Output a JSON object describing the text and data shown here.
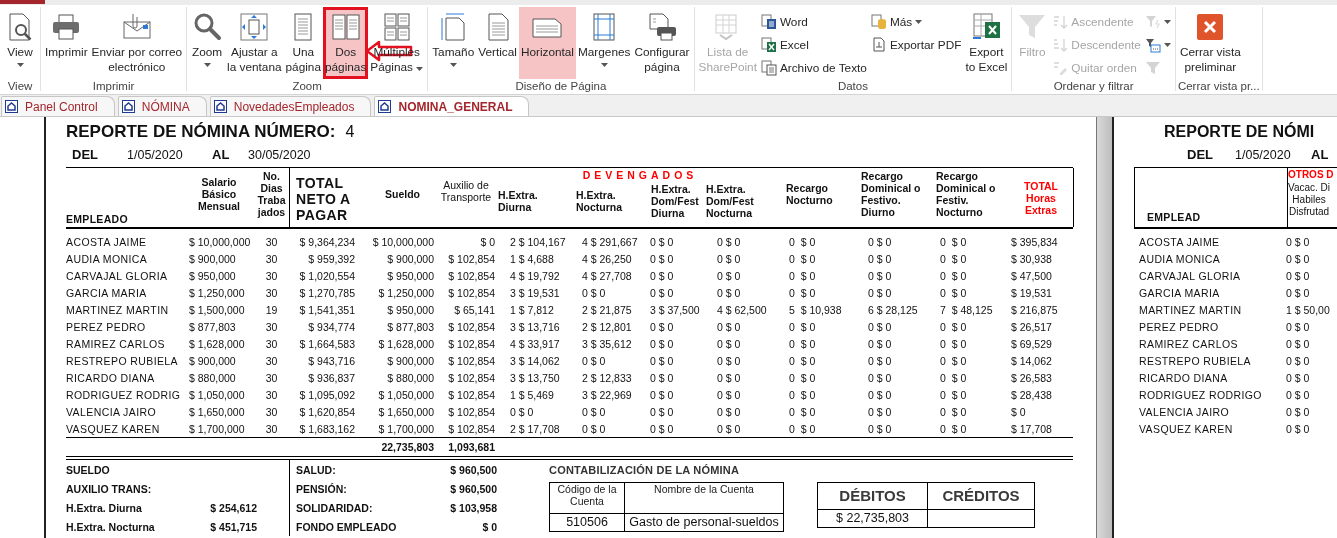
{
  "ribbon": {
    "groups": [
      {
        "label": "View",
        "items": [
          {
            "kind": "large",
            "label": "View",
            "dropdown": true,
            "disabled": false,
            "selected": false
          }
        ]
      },
      {
        "label": "Imprimir",
        "items": [
          {
            "kind": "large",
            "label": "Imprimir",
            "dropdown": false,
            "disabled": false,
            "selected": false
          },
          {
            "kind": "large",
            "label": "Enviar por correo\nelectrónico",
            "dropdown": false,
            "disabled": false,
            "selected": false
          }
        ]
      },
      {
        "label": "Zoom",
        "items": [
          {
            "kind": "large",
            "label": "Zoom",
            "dropdown": true,
            "disabled": false,
            "selected": false
          },
          {
            "kind": "large",
            "label": "Ajustar a\nla ventana",
            "dropdown": false,
            "disabled": false,
            "selected": false
          },
          {
            "kind": "large",
            "label": "Una\npágina",
            "dropdown": false,
            "disabled": false,
            "selected": false
          },
          {
            "kind": "large",
            "label": "Dos\npáginas",
            "dropdown": false,
            "disabled": false,
            "selected": true,
            "annotated": true
          },
          {
            "kind": "large",
            "label": "Múltiples\nPáginas",
            "dropdown": true,
            "disabled": false,
            "selected": false
          }
        ]
      },
      {
        "label": "Diseño de Página",
        "items": [
          {
            "kind": "large",
            "label": "Tamaño",
            "dropdown": true,
            "disabled": false,
            "selected": false
          },
          {
            "kind": "large",
            "label": "Vertical",
            "dropdown": false,
            "disabled": false,
            "selected": false
          },
          {
            "kind": "large",
            "label": "Horizontal",
            "dropdown": false,
            "disabled": false,
            "selected": true
          },
          {
            "kind": "large",
            "label": "Margenes",
            "dropdown": true,
            "disabled": false,
            "selected": false
          },
          {
            "kind": "large",
            "label": "Configurar\npágina",
            "dropdown": false,
            "disabled": false,
            "selected": false
          }
        ]
      },
      {
        "label": "Datos",
        "items": [
          {
            "kind": "large",
            "label": "Lista de\nSharePoint",
            "dropdown": false,
            "disabled": true,
            "selected": false
          },
          {
            "kind": "stack",
            "items": [
              {
                "label": "Word",
                "dropdown": false,
                "disabled": false
              },
              {
                "label": "Excel",
                "dropdown": false,
                "disabled": false
              },
              {
                "label": "Archivo de Texto",
                "dropdown": false,
                "disabled": false
              }
            ]
          },
          {
            "kind": "stack",
            "items": [
              {
                "label": "Más",
                "dropdown": true,
                "disabled": false
              },
              {
                "label": "Exportar PDF",
                "dropdown": false,
                "disabled": false
              }
            ]
          },
          {
            "kind": "large",
            "label": "Export\nto Excel",
            "dropdown": false,
            "disabled": false,
            "selected": false
          }
        ]
      },
      {
        "label": "Ordenar y filtrar",
        "items": [
          {
            "kind": "large",
            "label": "Filtro",
            "dropdown": false,
            "disabled": true,
            "selected": false
          },
          {
            "kind": "stack",
            "items": [
              {
                "label": "Ascendente",
                "dropdown": false,
                "disabled": true
              },
              {
                "label": "Descendente",
                "dropdown": false,
                "disabled": true
              },
              {
                "label": "Quitar orden",
                "dropdown": false,
                "disabled": true
              }
            ]
          },
          {
            "kind": "stack",
            "items": [
              {
                "dropdown": true,
                "disabled": true
              },
              {
                "dropdown": true,
                "disabled": false
              },
              {
                "dropdown": false,
                "disabled": true
              }
            ]
          }
        ]
      },
      {
        "label": "Cerrar vista pr...",
        "items": [
          {
            "kind": "large",
            "label": "Cerrar vista\npreliminar",
            "dropdown": false,
            "disabled": false,
            "selected": false
          }
        ]
      }
    ]
  },
  "tabs": [
    {
      "label": "Panel Control",
      "selected": false
    },
    {
      "label": "NÓMINA",
      "selected": false
    },
    {
      "label": "NovedadesEmpleados",
      "selected": false
    },
    {
      "label": "NOMINA_GENERAL",
      "selected": true
    }
  ],
  "report": {
    "title": "REPORTE DE NÓMINA NÚMERO:",
    "number": "4",
    "from_label": "DEL",
    "from": "1/05/2020",
    "to_label": "AL",
    "to": "30/05/2020",
    "group_header": "DEVENGADOS",
    "columns": [
      {
        "header": "EMPLEADO",
        "kind": "name",
        "grouped": false
      },
      {
        "header": "Salario\nBásico\nMensual",
        "kind": "normal",
        "grouped": false
      },
      {
        "header": "No.\nDias\nTraba\njados",
        "kind": "normal",
        "grouped": false
      },
      {
        "header": "TOTAL\nNETO A\nPAGAR",
        "kind": "large",
        "grouped": false
      },
      {
        "header": "Sueldo",
        "kind": "normal",
        "grouped": false,
        "total": "22,735,803"
      },
      {
        "header": "Auxilio de\nTransporte",
        "kind": "light",
        "grouped": false,
        "total": "1,093,681"
      },
      {
        "header": "H.Extra.\nDiurna",
        "kind": "normal",
        "grouped": true
      },
      {
        "header": "H.Extra.\nNocturna",
        "kind": "normal",
        "grouped": true
      },
      {
        "header": "H.Extra.\nDom/Fest\nDiurna",
        "kind": "normal",
        "grouped": true
      },
      {
        "header": "H.Extra.\nDom/Fest\nNocturna",
        "kind": "normal",
        "grouped": true
      },
      {
        "header": "Recargo\nNocturno",
        "kind": "normal",
        "grouped": false
      },
      {
        "header": "Recargo\nDominical o\nFestivo.\nDiurno",
        "kind": "normal",
        "grouped": false
      },
      {
        "header": "Recargo\nDominical o\nFestiv.\nNocturno",
        "kind": "normal",
        "grouped": false
      },
      {
        "header": "TOTAL\nHoras\nExtras",
        "kind": "accent",
        "grouped": false
      }
    ],
    "rows": [
      {
        "cells": [
          "ACOSTA JAIME",
          "$ 10,000,000",
          "30",
          "$ 9,364,234",
          "$ 10,000,000",
          "$ 0",
          "2 $ 104,167",
          "4 $ 291,667",
          "0 $ 0",
          "0 $ 0",
          "0  $ 0",
          "0 $ 0",
          "0  $ 0",
          "$ 395,834"
        ]
      },
      {
        "cells": [
          "AUDIA MONICA",
          "$ 900,000",
          "30",
          "$ 959,392",
          "$ 900,000",
          "$ 102,854",
          "1 $ 4,688",
          "4 $ 26,250",
          "0 $ 0",
          "0 $ 0",
          "0  $ 0",
          "0 $ 0",
          "0  $ 0",
          "$ 30,938"
        ]
      },
      {
        "cells": [
          "CARVAJAL GLORIA",
          "$ 950,000",
          "30",
          "$ 1,020,554",
          "$ 950,000",
          "$ 102,854",
          "4 $ 19,792",
          "4 $ 27,708",
          "0 $ 0",
          "0 $ 0",
          "0  $ 0",
          "0 $ 0",
          "0  $ 0",
          "$ 47,500"
        ]
      },
      {
        "cells": [
          "GARCIA MARIA",
          "$ 1,250,000",
          "30",
          "$ 1,270,785",
          "$ 1,250,000",
          "$ 102,854",
          "3 $ 19,531",
          "0 $ 0",
          "0 $ 0",
          "0 $ 0",
          "0  $ 0",
          "0 $ 0",
          "0  $ 0",
          "$ 19,531"
        ]
      },
      {
        "cells": [
          "MARTINEZ MARTIN",
          "$ 1,500,000",
          "19",
          "$ 1,541,351",
          "$ 950,000",
          "$ 65,141",
          "1 $ 7,812",
          "2 $ 21,875",
          "3 $ 37,500",
          "4 $ 62,500",
          "5  $ 10,938",
          "6 $ 28,125",
          "7  $ 48,125",
          "$ 216,875"
        ]
      },
      {
        "cells": [
          "PEREZ PEDRO",
          "$ 877,803",
          "30",
          "$ 934,774",
          "$ 877,803",
          "$ 102,854",
          "3 $ 13,716",
          "2 $ 12,801",
          "0 $ 0",
          "0 $ 0",
          "0  $ 0",
          "0 $ 0",
          "0  $ 0",
          "$ 26,517"
        ]
      },
      {
        "cells": [
          "RAMIREZ CARLOS",
          "$ 1,628,000",
          "30",
          "$ 1,664,583",
          "$ 1,628,000",
          "$ 102,854",
          "4 $ 33,917",
          "3 $ 35,612",
          "0 $ 0",
          "0 $ 0",
          "0  $ 0",
          "0 $ 0",
          "0  $ 0",
          "$ 69,529"
        ]
      },
      {
        "cells": [
          "RESTREPO RUBIELA",
          "$ 900,000",
          "30",
          "$ 943,716",
          "$ 900,000",
          "$ 102,854",
          "3 $ 14,062",
          "0 $ 0",
          "0 $ 0",
          "0 $ 0",
          "0  $ 0",
          "0 $ 0",
          "0  $ 0",
          "$ 14,062"
        ]
      },
      {
        "cells": [
          "RICARDO DIANA",
          "$ 880,000",
          "30",
          "$ 936,837",
          "$ 880,000",
          "$ 102,854",
          "3 $ 13,750",
          "2 $ 12,833",
          "0 $ 0",
          "0 $ 0",
          "0  $ 0",
          "0 $ 0",
          "0  $ 0",
          "$ 26,583"
        ]
      },
      {
        "cells": [
          "RODRIGUEZ RODRIG",
          "$ 1,050,000",
          "30",
          "$ 1,095,092",
          "$ 1,050,000",
          "$ 102,854",
          "1 $ 5,469",
          "3 $ 22,969",
          "0 $ 0",
          "0 $ 0",
          "0  $ 0",
          "0 $ 0",
          "0  $ 0",
          "$ 28,438"
        ]
      },
      {
        "cells": [
          "VALENCIA JAIRO",
          "$ 1,650,000",
          "30",
          "$ 1,620,854",
          "$ 1,650,000",
          "$ 102,854",
          "0 $ 0",
          "0 $ 0",
          "0 $ 0",
          "0 $ 0",
          "0  $ 0",
          "0 $ 0",
          "0  $ 0",
          "$ 0"
        ]
      },
      {
        "cells": [
          "VASQUEZ KAREN",
          "$ 1,700,000",
          "30",
          "$ 1,683,162",
          "$ 1,700,000",
          "$ 102,854",
          "2 $ 17,708",
          "0 $ 0",
          "0 $ 0",
          "0 $ 0",
          "0  $ 0",
          "0 $ 0",
          "0  $ 0",
          "$ 17,708"
        ]
      }
    ],
    "earnings": [
      {
        "label": "SUELDO"
      },
      {
        "label": "AUXILIO TRANS:"
      },
      {
        "label": "H.Extra. Diurna",
        "value": "$ 254,612"
      },
      {
        "label": "H.Extra. Nocturna",
        "value": "$ 451,715"
      }
    ],
    "deductions": [
      {
        "label": "SALUD:",
        "value": "$ 960,500"
      },
      {
        "label": "PENSIÓN:",
        "value": "$ 960,500"
      },
      {
        "label": "SOLIDARIDAD:",
        "value": "$ 103,958"
      },
      {
        "label": "FONDO EMPLEADO",
        "value": "$ 0"
      }
    ],
    "accounting": {
      "title": "CONTABILIZACIÓN DE LA NÓMINA",
      "columns": [
        "Código de la\nCuenta",
        "Nombre de la Cuenta"
      ],
      "rows": [
        [
          "510506",
          "Gasto de personal-sueldos"
        ]
      ],
      "amount_columns": [
        "DÉBITOS",
        "CRÉDITOS"
      ],
      "amount_rows": [
        [
          "$ 22,735,803"
        ]
      ]
    }
  },
  "page2": {
    "title": "REPORTE DE NÓMI",
    "from_label": "DEL",
    "from": "1/05/2020",
    "to_label": "AL",
    "name_header": "EMPLEAD",
    "group_header": "OTROS D",
    "value_header": "Vacac. Di\nHabiles\nDisfrutad",
    "rows": [
      {
        "cells": [
          "ACOSTA JAIME",
          "0 $ 0"
        ]
      },
      {
        "cells": [
          "AUDIA MONICA",
          "0 $ 0"
        ]
      },
      {
        "cells": [
          "CARVAJAL GLORIA",
          "0 $ 0"
        ]
      },
      {
        "cells": [
          "GARCIA MARIA",
          "0 $ 0"
        ]
      },
      {
        "cells": [
          "MARTINEZ MARTIN",
          "1 $ 50,00"
        ]
      },
      {
        "cells": [
          "PEREZ PEDRO",
          "0 $ 0"
        ]
      },
      {
        "cells": [
          "RAMIREZ CARLOS",
          "0 $ 0"
        ]
      },
      {
        "cells": [
          "RESTREPO RUBIELA",
          "0 $ 0"
        ]
      },
      {
        "cells": [
          "RICARDO DIANA",
          "0 $ 0"
        ]
      },
      {
        "cells": [
          "RODRIGUEZ RODRIGO",
          "0 $ 0"
        ]
      },
      {
        "cells": [
          "VALENCIA JAIRO",
          "0 $ 0"
        ]
      },
      {
        "cells": [
          "VASQUEZ KAREN",
          "0 $ 0"
        ]
      }
    ]
  }
}
